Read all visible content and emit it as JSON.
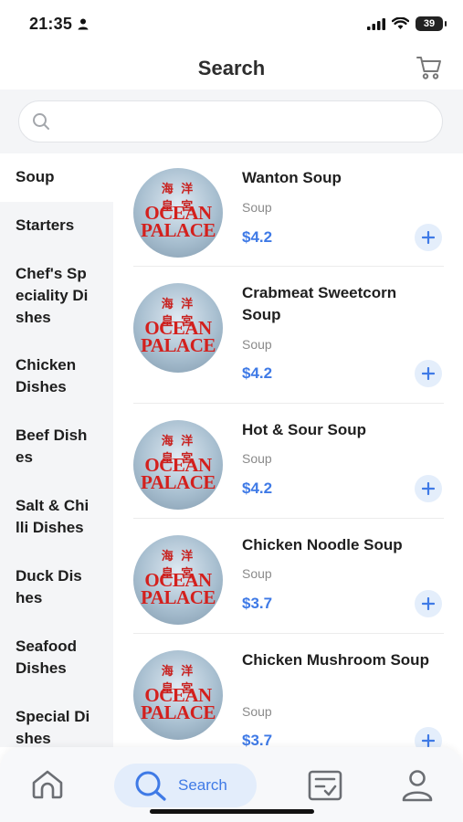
{
  "status": {
    "time": "21:35",
    "battery": "39"
  },
  "header": {
    "title": "Search"
  },
  "search": {
    "placeholder": ""
  },
  "sidebar": {
    "items": [
      {
        "label": "Soup",
        "lines": [
          "Soup"
        ],
        "active": true
      },
      {
        "label": "Starters",
        "lines": [
          "Starters"
        ]
      },
      {
        "label": "Chef's Speciality Dishes",
        "lines": [
          "Chef's Sp",
          "eciality Di",
          "shes"
        ]
      },
      {
        "label": "Chicken Dishes",
        "lines": [
          "Chicken",
          "Dishes"
        ]
      },
      {
        "label": "Beef Dishes",
        "lines": [
          "Beef Dish",
          "es"
        ]
      },
      {
        "label": "Salt & Chilli Dishes",
        "lines": [
          "Salt & Chi",
          "lli Dishes"
        ]
      },
      {
        "label": "Duck Dishes",
        "lines": [
          "Duck Dis",
          "hes"
        ]
      },
      {
        "label": "Seafood Dishes",
        "lines": [
          "Seafood",
          "Dishes"
        ]
      },
      {
        "label": "Special Dishes",
        "lines": [
          "Special Di",
          "shes"
        ]
      }
    ]
  },
  "logo": {
    "seal": "海 洋",
    "seal2": "皇 宮",
    "brand_line1": "OCEAN",
    "brand_line2": "PALACE"
  },
  "products": [
    {
      "name": "Wanton Soup",
      "category": "Soup",
      "price": "$4.2"
    },
    {
      "name": "Crabmeat Sweetcorn Soup",
      "category": "Soup",
      "price": "$4.2"
    },
    {
      "name": "Hot & Sour Soup",
      "category": "Soup",
      "price": "$4.2"
    },
    {
      "name": "Chicken Noodle Soup",
      "category": "Soup",
      "price": "$3.7"
    },
    {
      "name": "Chicken Mushroom Soup",
      "category": "Soup",
      "price": "$3.7"
    }
  ],
  "bottom_nav": {
    "search_label": "Search"
  },
  "colors": {
    "accent": "#3f7ae6",
    "accent_light": "#e3edfb",
    "sidebar_bg": "#f4f5f7",
    "logo_red": "#d3201d"
  }
}
